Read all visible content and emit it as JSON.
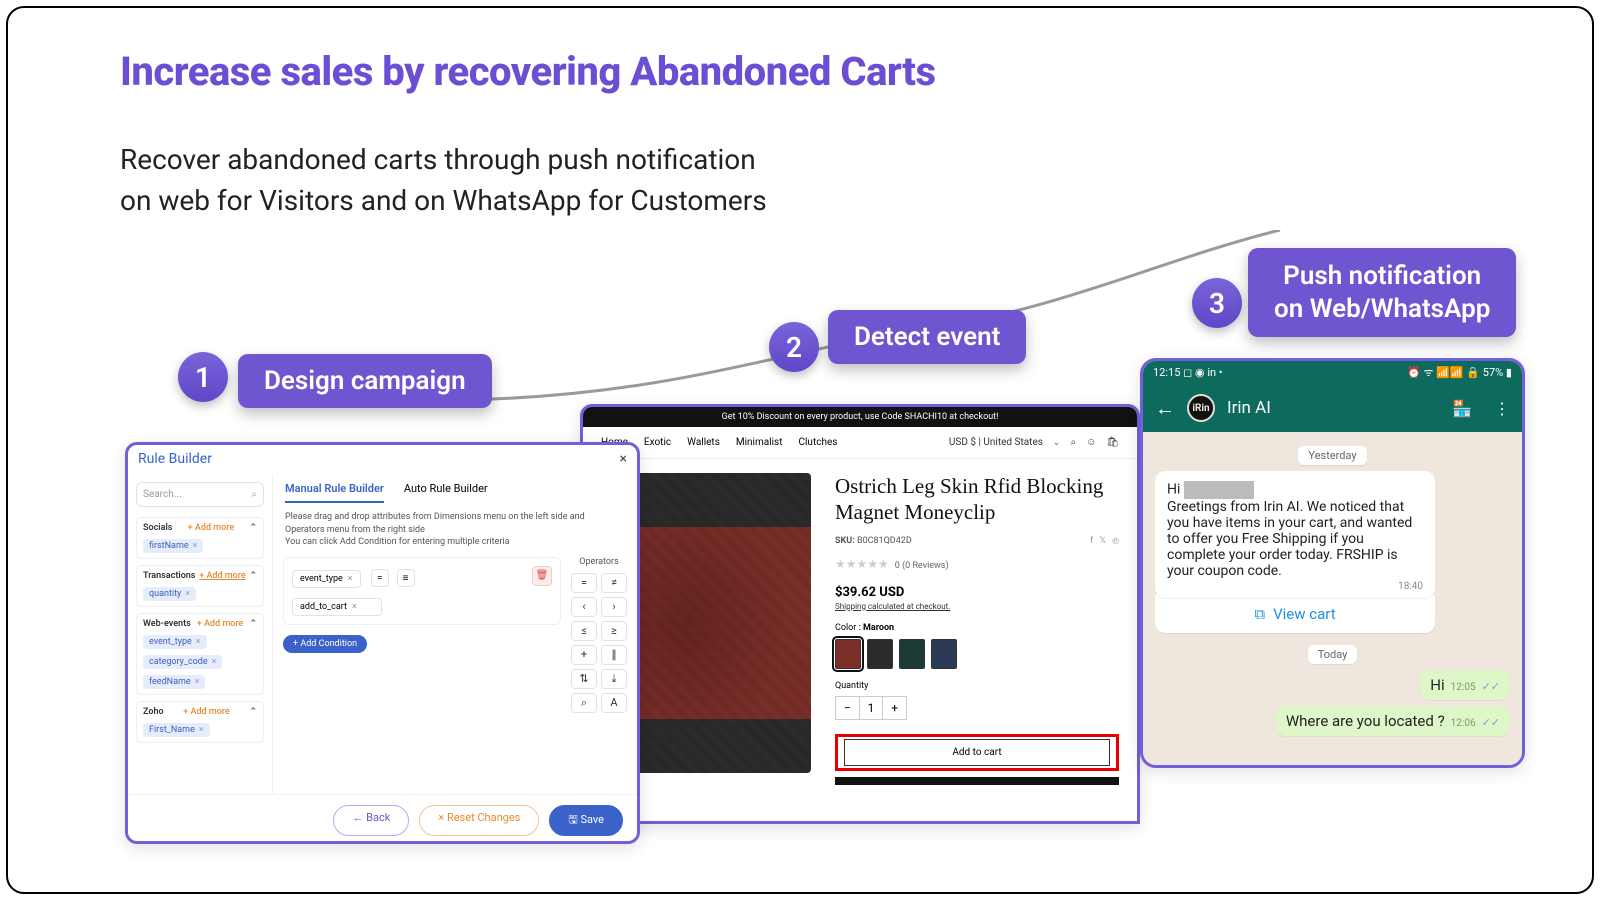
{
  "title": "Increase sales by recovering Abandoned Carts",
  "subtitle_l1": "Recover abandoned carts through push notification",
  "subtitle_l2": "on web for Visitors and on WhatsApp for Customers",
  "steps": {
    "s1": {
      "num": "1",
      "label": "Design campaign"
    },
    "s2": {
      "num": "2",
      "label": "Detect event"
    },
    "s3": {
      "num": "3",
      "label_l1": "Push notification",
      "label_l2": "on Web/WhatsApp"
    }
  },
  "rulebuilder": {
    "title": "Rule Builder",
    "search_placeholder": "Search...",
    "tabs": {
      "manual": "Manual Rule Builder",
      "auto": "Auto Rule Builder"
    },
    "hint_l1": "Please drag and drop attributes from Dimensions menu on the left side and Operators menu from the right side",
    "hint_l2": "You can click Add Condition for entering multiple criteria",
    "groups": {
      "socials": {
        "name": "Socials",
        "addmore": "+  Add more",
        "tags": [
          "firstName"
        ]
      },
      "transactions": {
        "name": "Transactions",
        "addmore": "+  Add more",
        "tags": [
          "quantity"
        ]
      },
      "webevents": {
        "name": "Web-events",
        "addmore": "+  Add more",
        "tags": [
          "event_type",
          "category_code",
          "feedName"
        ]
      },
      "zoho": {
        "name": "Zoho",
        "addmore": "+  Add more",
        "tags": [
          "First_Name"
        ]
      }
    },
    "rule": {
      "attr": "event_type",
      "op": "=",
      "value": "add_to_cart"
    },
    "addcondition": "+  Add Condition",
    "operators_title": "Operators",
    "ops": [
      "=",
      "≠",
      "‹",
      "›",
      "≤",
      "≥",
      "+",
      "∥",
      "⇅",
      "⤓",
      "⌕",
      "A"
    ],
    "footer": {
      "back": "←  Back",
      "reset": "×  Reset Changes",
      "save": "🖫  Save"
    }
  },
  "product": {
    "banner": "Get 10% Discount on every product, use Code SHACHI10 at checkout!",
    "nav": [
      "Home",
      "Exotic",
      "Wallets",
      "Minimalist",
      "Clutches"
    ],
    "currency": "USD $ | United States",
    "title": "Ostrich Leg Skin Rfid Blocking Magnet Moneyclip",
    "sku_label": "SKU:",
    "sku": "B0C81QD42D",
    "rating": "0 (0 Reviews)",
    "price": "$39.62 USD",
    "shipping": "Shipping calculated at checkout.",
    "color_label": "Color :",
    "color_value": "Maroon",
    "qty_label": "Quantity",
    "qty": "1",
    "addcart": "Add to cart"
  },
  "whatsapp": {
    "time": "12:15",
    "battery": "57%",
    "contact": "Irin AI",
    "yesterday": "Yesterday",
    "today": "Today",
    "greeting_prefix": "Hi ",
    "msg": "Greetings from Irin AI. We noticed that you have items in your cart, and wanted to offer you Free Shipping if you complete your order today. FRSHIP is your coupon code.",
    "msg_time": "18:40",
    "cta": "View cart",
    "out1": "Hi",
    "out1_time": "12:05",
    "out2": "Where are you located ?",
    "out2_time": "12:06"
  }
}
